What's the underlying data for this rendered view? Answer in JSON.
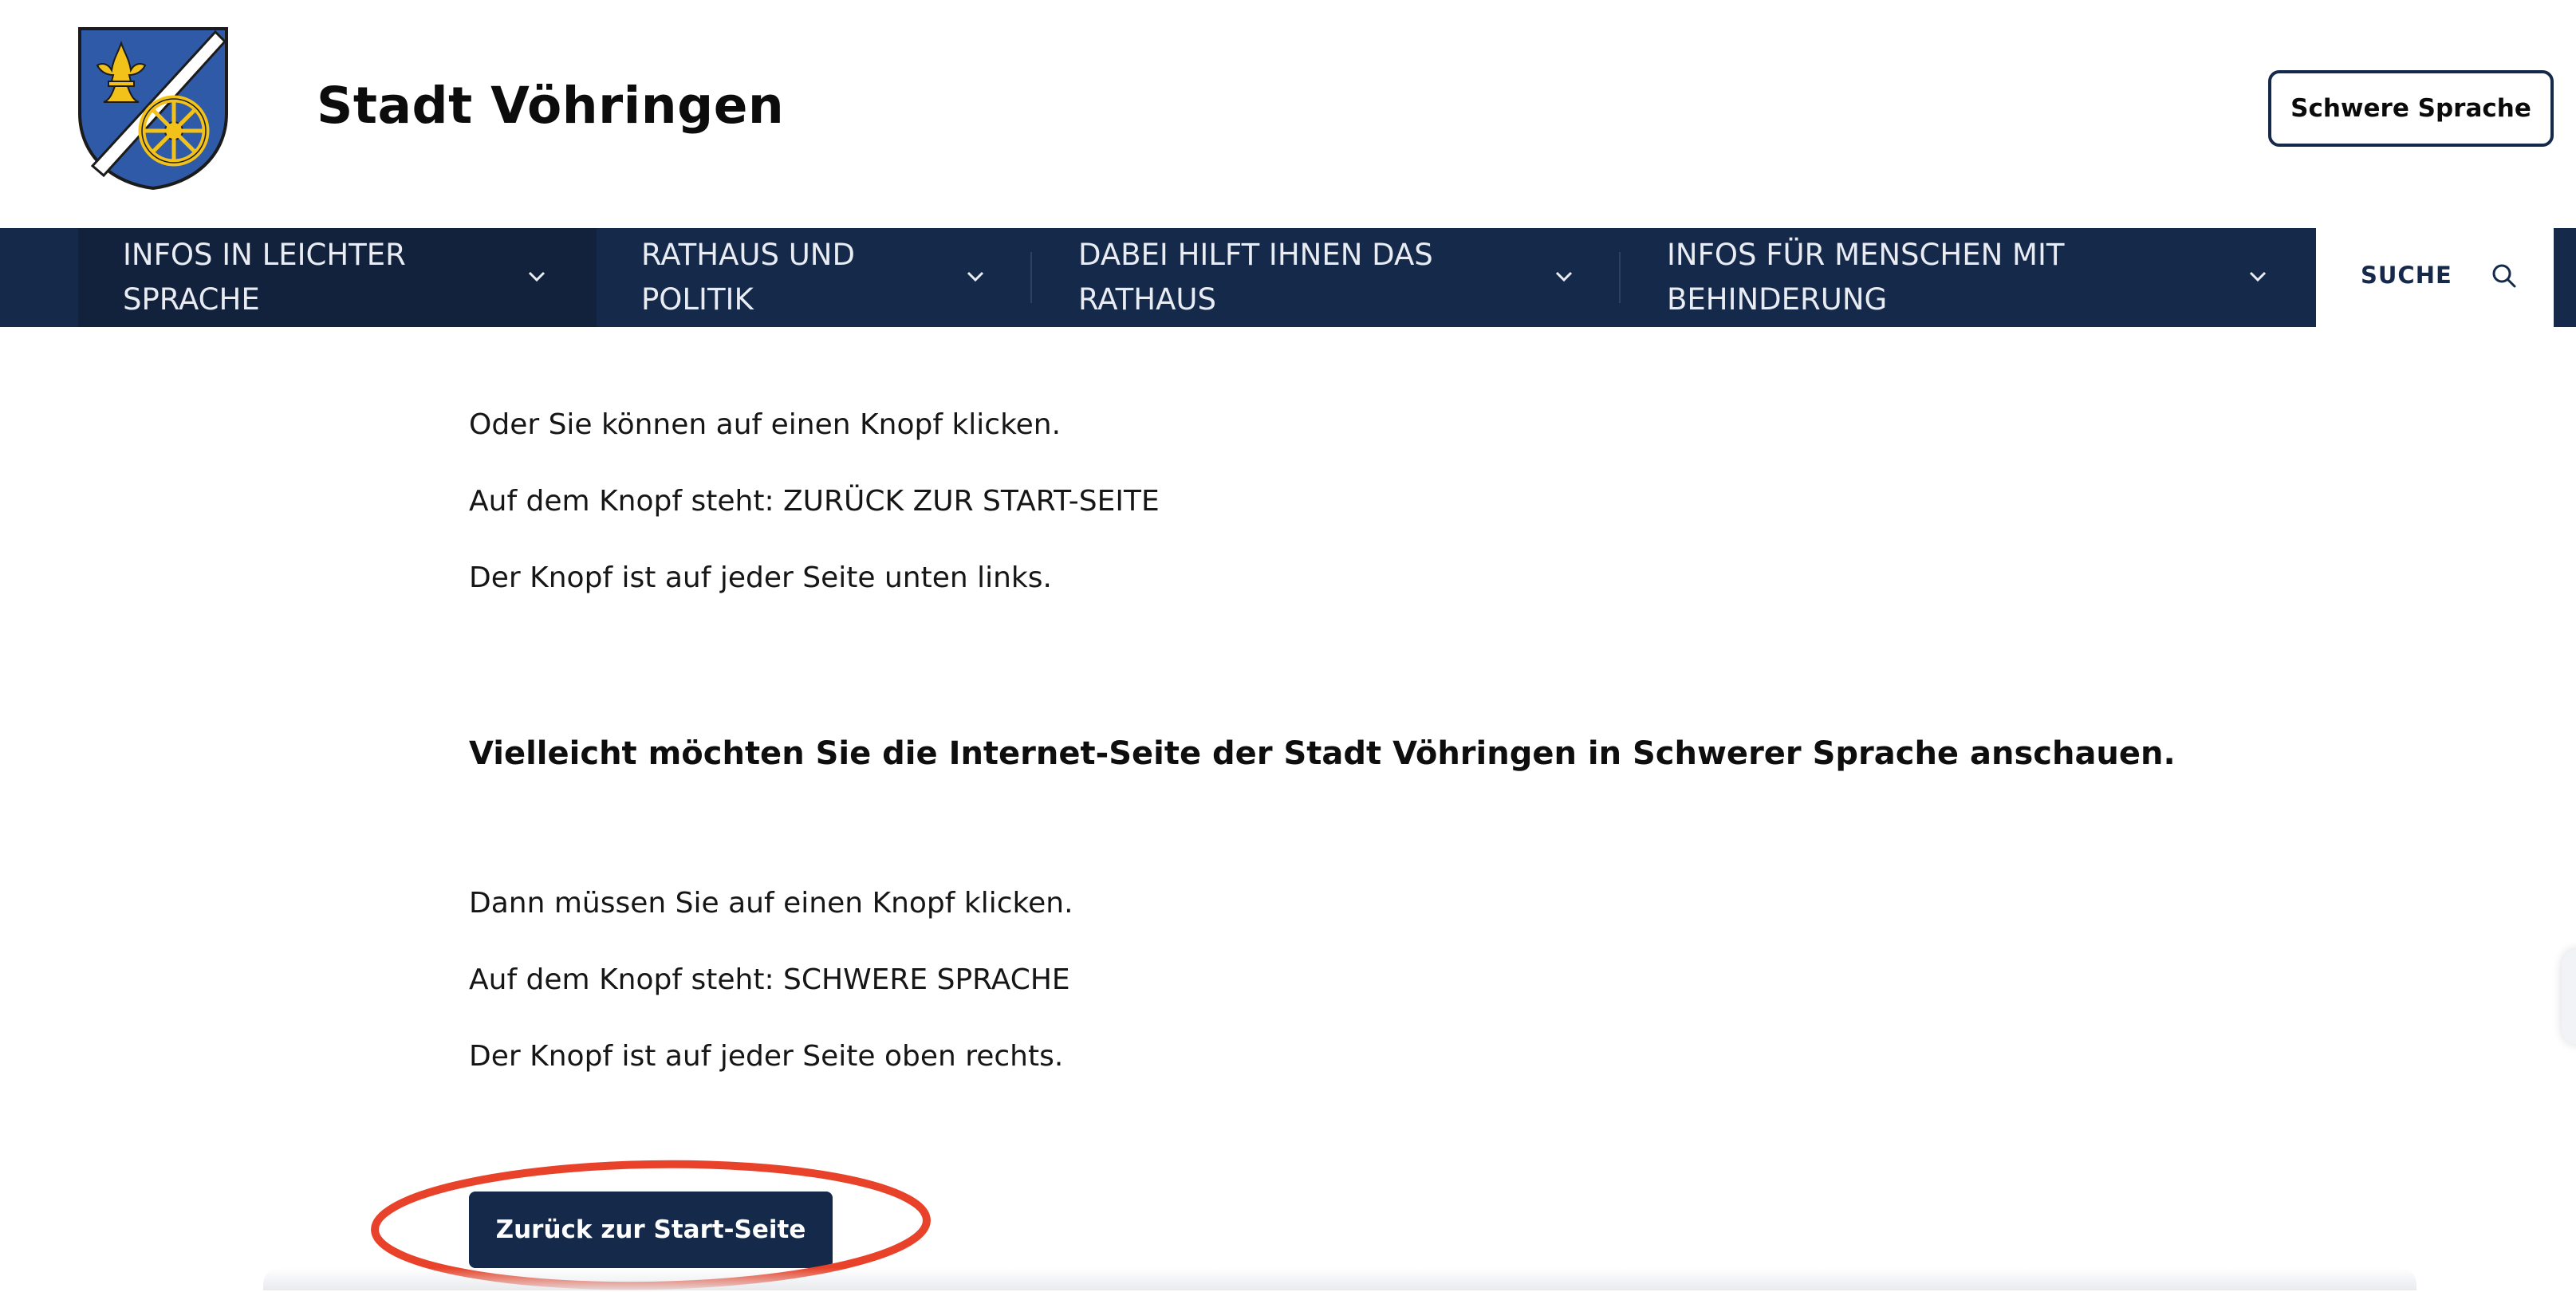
{
  "header": {
    "site_title": "Stadt Vöhringen",
    "language_button": "Schwere Sprache"
  },
  "nav": {
    "items": [
      {
        "label": "INFOS IN LEICHTER SPRACHE",
        "active": true
      },
      {
        "label": "RATHAUS UND POLITIK",
        "active": false
      },
      {
        "label": "DABEI HILFT IHNEN DAS RATHAUS",
        "active": false
      },
      {
        "label": "INFOS FÜR MENSCHEN MIT BEHINDERUNG",
        "active": false
      }
    ],
    "search_label": "SUCHE"
  },
  "content": {
    "paragraphs_top": [
      "Oder Sie können auf einen Knopf klicken.",
      "Auf dem Knopf steht: ZURÜCK ZUR START-SEITE",
      "Der Knopf ist auf jeder Seite unten links."
    ],
    "headline": "Vielleicht möchten Sie die Internet-Seite der Stadt Vöhringen in Schwerer Sprache anschauen.",
    "paragraphs_bottom": [
      "Dann müssen Sie auf einen Knopf klicken.",
      "Auf dem Knopf steht: SCHWERE SPRACHE",
      "Der Knopf ist auf jeder Seite oben rechts."
    ],
    "start_button": "Zurück zur Start-Seite"
  },
  "colors": {
    "brand_navy": "#15294a",
    "highlight_red": "#e8432a",
    "crest_blue": "#2f5aa8",
    "crest_gold": "#f2c21b"
  }
}
